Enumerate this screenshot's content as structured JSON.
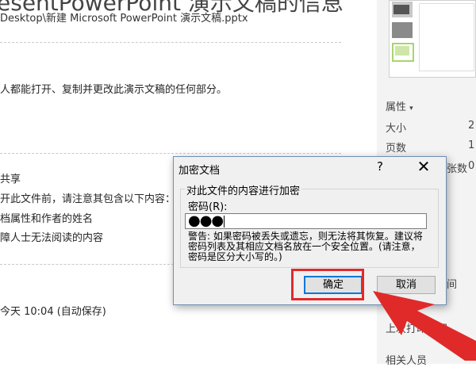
{
  "page": {
    "title_fragment": "esentPowerPoint 演示文稿的信息",
    "path": "Desktop\\新建 Microsoft PowerPoint 演示文稿.pptx",
    "permissions_text": "人都能打开、复制并更改此演示文稿的任何部分。",
    "share_heading": "共享",
    "share_text": "开此文件前，请注意其包含以下内容：",
    "share_item_1": "档属性和作者的姓名",
    "share_item_2": "障人士无法阅读的内容",
    "autosave_text": "今天 10:04 (自动保存)"
  },
  "side_panel": {
    "properties_label": "属性",
    "size_label": "大小",
    "size_value": "2",
    "pages_label": "页数",
    "pages_value": "1",
    "hidden_label": "张数",
    "hidden_value": "0",
    "time_label": "间",
    "last_print_label": "上次打印时间",
    "related_people_label": "相关人员"
  },
  "dialog": {
    "title": "加密文档",
    "help_glyph": "?",
    "close_glyph": "✕",
    "group_label": "对此文件的内容进行加密",
    "password_label": "密码(R):",
    "password_value": "●●●",
    "warning": "警告: 如果密码被丢失或遗忘，则无法将其恢复。建议将密码列表及其相应文档名放在一个安全位置。(请注意，密码是区分大小写的。)",
    "ok_label": "确定",
    "cancel_label": "取消"
  },
  "colors": {
    "highlight": "#e02a2a",
    "arrow": "#e02a2a",
    "dialog_bg": "#f0f0f0"
  }
}
